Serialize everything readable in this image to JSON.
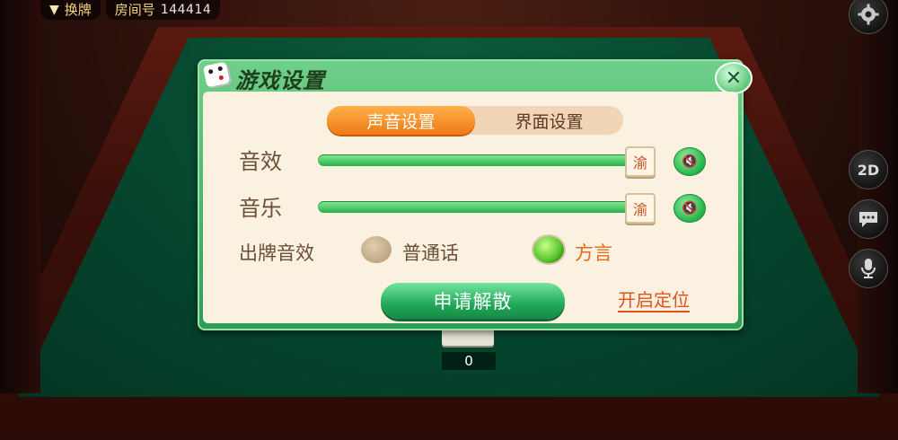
{
  "topbar": {
    "swap_label": "换牌",
    "room_label": "房间号",
    "room_number": "144414"
  },
  "side_buttons": {
    "mode_label": "2D"
  },
  "table": {
    "counter": "0"
  },
  "dialog": {
    "title": "游戏设置",
    "tabs": [
      {
        "label": "声音设置",
        "active": true
      },
      {
        "label": "界面设置",
        "active": false
      }
    ],
    "sound_effect": {
      "label": "音效",
      "level": 1.0,
      "knob_glyph": "渝"
    },
    "music": {
      "label": "音乐",
      "level": 1.0,
      "knob_glyph": "渝"
    },
    "card_voice": {
      "label": "出牌音效",
      "options": [
        {
          "label": "普通话",
          "selected": false
        },
        {
          "label": "方言",
          "selected": true
        }
      ]
    },
    "dissolve_button": "申请解散",
    "location_link": "开启定位"
  },
  "colors": {
    "accent_green": "#26b24a",
    "accent_orange": "#f07a16",
    "link_orange": "#e0521a"
  }
}
